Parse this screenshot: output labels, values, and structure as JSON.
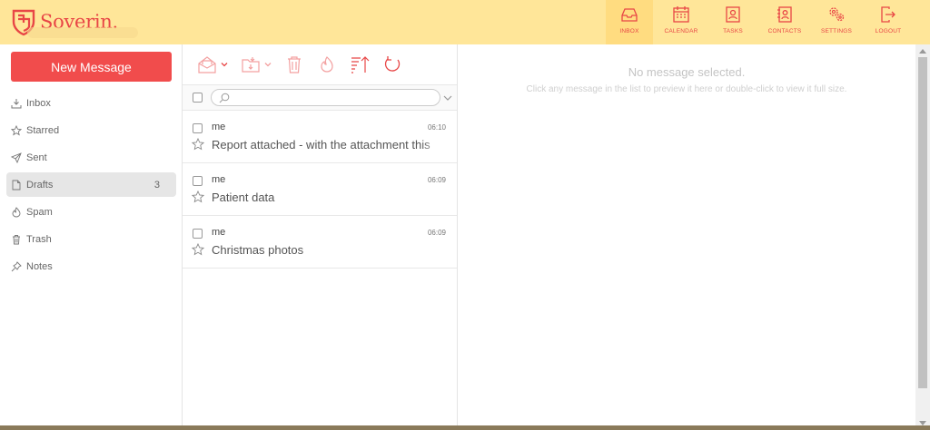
{
  "colors": {
    "accent": "#e84646",
    "header_bg": "#ffe699",
    "button_bg": "#f14c4c"
  },
  "brand": {
    "name": "Soverin."
  },
  "nav": [
    {
      "label": "INBOX",
      "icon": "inbox-icon",
      "active": true
    },
    {
      "label": "CALENDAR",
      "icon": "calendar-icon"
    },
    {
      "label": "TASKS",
      "icon": "tasks-icon"
    },
    {
      "label": "CONTACTS",
      "icon": "contacts-icon"
    },
    {
      "label": "SETTINGS",
      "icon": "settings-icon"
    },
    {
      "label": "LOGOUT",
      "icon": "logout-icon"
    }
  ],
  "sidebar": {
    "new_message": "New Message",
    "folders": [
      {
        "label": "Inbox",
        "icon": "inbox-icon",
        "count": ""
      },
      {
        "label": "Starred",
        "icon": "star-icon",
        "count": ""
      },
      {
        "label": "Sent",
        "icon": "send-icon",
        "count": ""
      },
      {
        "label": "Drafts",
        "icon": "draft-icon",
        "count": "3",
        "active": true
      },
      {
        "label": "Spam",
        "icon": "fire-icon",
        "count": ""
      },
      {
        "label": "Trash",
        "icon": "trash-icon",
        "count": ""
      },
      {
        "label": "Notes",
        "icon": "pin-icon",
        "count": ""
      }
    ]
  },
  "list": {
    "search": {
      "value": "",
      "placeholder": ""
    },
    "messages": [
      {
        "from": "me",
        "time": "06:10",
        "subject": "Report attached - with the attachment this"
      },
      {
        "from": "me",
        "time": "06:09",
        "subject": "Patient data"
      },
      {
        "from": "me",
        "time": "06:09",
        "subject": "Christmas photos"
      }
    ]
  },
  "preview": {
    "title": "No message selected.",
    "hint": "Click any message in the list to preview it here or double-click to view it full size."
  }
}
